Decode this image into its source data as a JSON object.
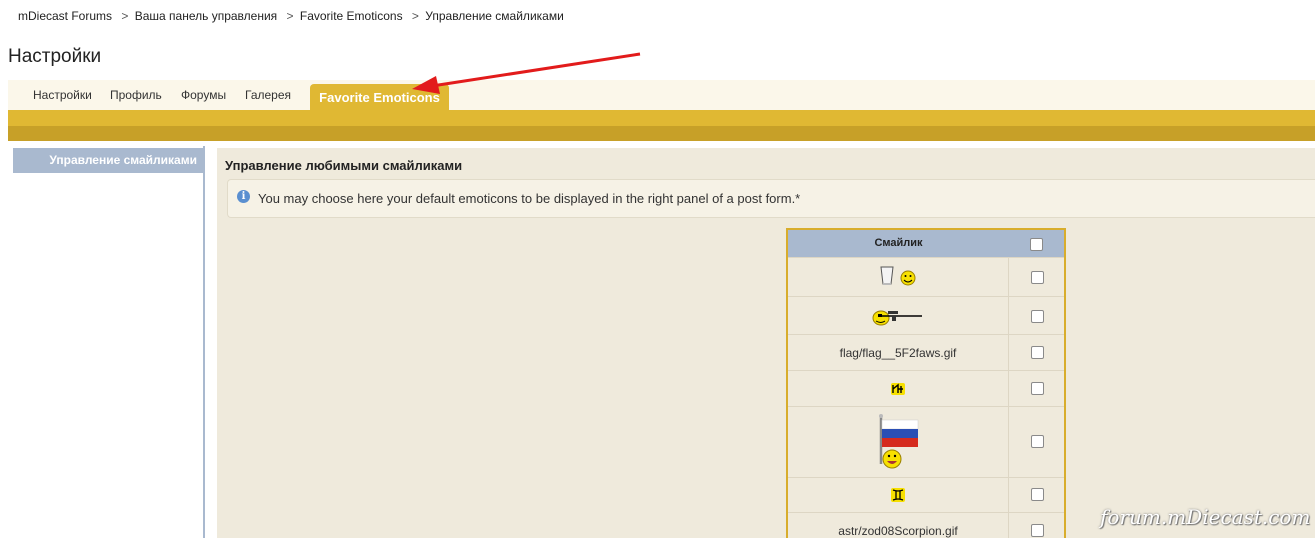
{
  "breadcrumb": {
    "items": [
      "mDiecast Forums",
      "Ваша панель управления",
      "Favorite Emoticons",
      "Управление смайликами"
    ],
    "separator": ">"
  },
  "page_title": "Настройки",
  "tabs": [
    {
      "label": "Настройки"
    },
    {
      "label": "Профиль"
    },
    {
      "label": "Форумы"
    },
    {
      "label": "Галерея"
    },
    {
      "label": "Favorite Emoticons",
      "active": true
    }
  ],
  "sidebar": {
    "items": [
      {
        "label": "Управление смайликами",
        "active": true
      }
    ]
  },
  "main": {
    "title": "Управление любимыми смайликами",
    "info_icon": "info-icon",
    "info_text": "You may choose here your default emoticons to be displayed in the right panel of a post form.*"
  },
  "table": {
    "header": "Смайлик",
    "rows": [
      {
        "type": "image",
        "icon": "cup-smiley-icon"
      },
      {
        "type": "image",
        "icon": "sniper-smiley-icon"
      },
      {
        "type": "text",
        "label": "flag/flag__5F2faws.gif"
      },
      {
        "type": "image",
        "icon": "zodiac-glyph-icon"
      },
      {
        "type": "image",
        "icon": "russian-flag-smiley-icon"
      },
      {
        "type": "image",
        "icon": "gemini-glyph-icon"
      },
      {
        "type": "text",
        "label": "astr/zod08Scorpion.gif"
      }
    ]
  },
  "watermark": "forum.mDiecast.com",
  "colors": {
    "tab_active": "#e0b833",
    "bar_dark": "#c7a028",
    "sidebar_blue": "#a9b9cf",
    "panel_bg": "#efeadc",
    "annotation_arrow": "#e21b1b"
  }
}
